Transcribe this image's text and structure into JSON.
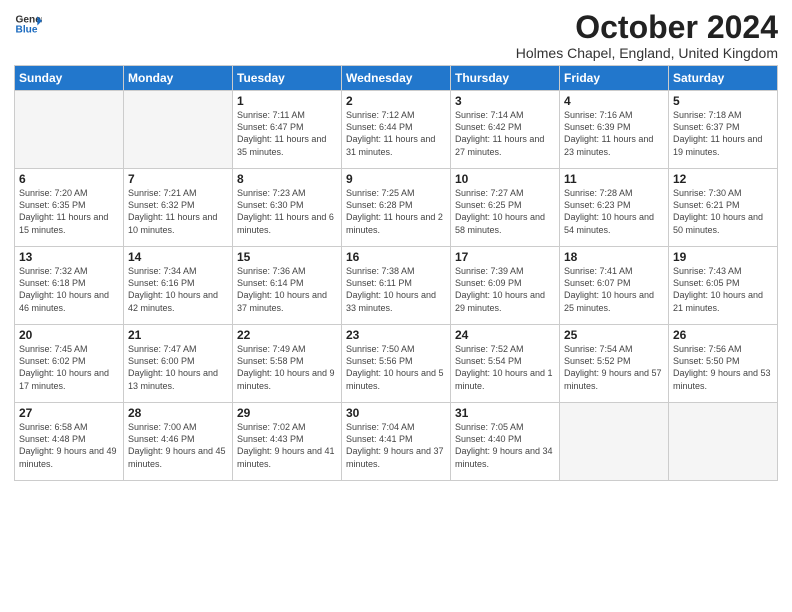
{
  "logo": {
    "line1": "General",
    "line2": "Blue"
  },
  "title": "October 2024",
  "location": "Holmes Chapel, England, United Kingdom",
  "days_header": [
    "Sunday",
    "Monday",
    "Tuesday",
    "Wednesday",
    "Thursday",
    "Friday",
    "Saturday"
  ],
  "weeks": [
    [
      {
        "day": "",
        "info": ""
      },
      {
        "day": "",
        "info": ""
      },
      {
        "day": "1",
        "info": "Sunrise: 7:11 AM\nSunset: 6:47 PM\nDaylight: 11 hours and 35 minutes."
      },
      {
        "day": "2",
        "info": "Sunrise: 7:12 AM\nSunset: 6:44 PM\nDaylight: 11 hours and 31 minutes."
      },
      {
        "day": "3",
        "info": "Sunrise: 7:14 AM\nSunset: 6:42 PM\nDaylight: 11 hours and 27 minutes."
      },
      {
        "day": "4",
        "info": "Sunrise: 7:16 AM\nSunset: 6:39 PM\nDaylight: 11 hours and 23 minutes."
      },
      {
        "day": "5",
        "info": "Sunrise: 7:18 AM\nSunset: 6:37 PM\nDaylight: 11 hours and 19 minutes."
      }
    ],
    [
      {
        "day": "6",
        "info": "Sunrise: 7:20 AM\nSunset: 6:35 PM\nDaylight: 11 hours and 15 minutes."
      },
      {
        "day": "7",
        "info": "Sunrise: 7:21 AM\nSunset: 6:32 PM\nDaylight: 11 hours and 10 minutes."
      },
      {
        "day": "8",
        "info": "Sunrise: 7:23 AM\nSunset: 6:30 PM\nDaylight: 11 hours and 6 minutes."
      },
      {
        "day": "9",
        "info": "Sunrise: 7:25 AM\nSunset: 6:28 PM\nDaylight: 11 hours and 2 minutes."
      },
      {
        "day": "10",
        "info": "Sunrise: 7:27 AM\nSunset: 6:25 PM\nDaylight: 10 hours and 58 minutes."
      },
      {
        "day": "11",
        "info": "Sunrise: 7:28 AM\nSunset: 6:23 PM\nDaylight: 10 hours and 54 minutes."
      },
      {
        "day": "12",
        "info": "Sunrise: 7:30 AM\nSunset: 6:21 PM\nDaylight: 10 hours and 50 minutes."
      }
    ],
    [
      {
        "day": "13",
        "info": "Sunrise: 7:32 AM\nSunset: 6:18 PM\nDaylight: 10 hours and 46 minutes."
      },
      {
        "day": "14",
        "info": "Sunrise: 7:34 AM\nSunset: 6:16 PM\nDaylight: 10 hours and 42 minutes."
      },
      {
        "day": "15",
        "info": "Sunrise: 7:36 AM\nSunset: 6:14 PM\nDaylight: 10 hours and 37 minutes."
      },
      {
        "day": "16",
        "info": "Sunrise: 7:38 AM\nSunset: 6:11 PM\nDaylight: 10 hours and 33 minutes."
      },
      {
        "day": "17",
        "info": "Sunrise: 7:39 AM\nSunset: 6:09 PM\nDaylight: 10 hours and 29 minutes."
      },
      {
        "day": "18",
        "info": "Sunrise: 7:41 AM\nSunset: 6:07 PM\nDaylight: 10 hours and 25 minutes."
      },
      {
        "day": "19",
        "info": "Sunrise: 7:43 AM\nSunset: 6:05 PM\nDaylight: 10 hours and 21 minutes."
      }
    ],
    [
      {
        "day": "20",
        "info": "Sunrise: 7:45 AM\nSunset: 6:02 PM\nDaylight: 10 hours and 17 minutes."
      },
      {
        "day": "21",
        "info": "Sunrise: 7:47 AM\nSunset: 6:00 PM\nDaylight: 10 hours and 13 minutes."
      },
      {
        "day": "22",
        "info": "Sunrise: 7:49 AM\nSunset: 5:58 PM\nDaylight: 10 hours and 9 minutes."
      },
      {
        "day": "23",
        "info": "Sunrise: 7:50 AM\nSunset: 5:56 PM\nDaylight: 10 hours and 5 minutes."
      },
      {
        "day": "24",
        "info": "Sunrise: 7:52 AM\nSunset: 5:54 PM\nDaylight: 10 hours and 1 minute."
      },
      {
        "day": "25",
        "info": "Sunrise: 7:54 AM\nSunset: 5:52 PM\nDaylight: 9 hours and 57 minutes."
      },
      {
        "day": "26",
        "info": "Sunrise: 7:56 AM\nSunset: 5:50 PM\nDaylight: 9 hours and 53 minutes."
      }
    ],
    [
      {
        "day": "27",
        "info": "Sunrise: 6:58 AM\nSunset: 4:48 PM\nDaylight: 9 hours and 49 minutes."
      },
      {
        "day": "28",
        "info": "Sunrise: 7:00 AM\nSunset: 4:46 PM\nDaylight: 9 hours and 45 minutes."
      },
      {
        "day": "29",
        "info": "Sunrise: 7:02 AM\nSunset: 4:43 PM\nDaylight: 9 hours and 41 minutes."
      },
      {
        "day": "30",
        "info": "Sunrise: 7:04 AM\nSunset: 4:41 PM\nDaylight: 9 hours and 37 minutes."
      },
      {
        "day": "31",
        "info": "Sunrise: 7:05 AM\nSunset: 4:40 PM\nDaylight: 9 hours and 34 minutes."
      },
      {
        "day": "",
        "info": ""
      },
      {
        "day": "",
        "info": ""
      }
    ]
  ]
}
